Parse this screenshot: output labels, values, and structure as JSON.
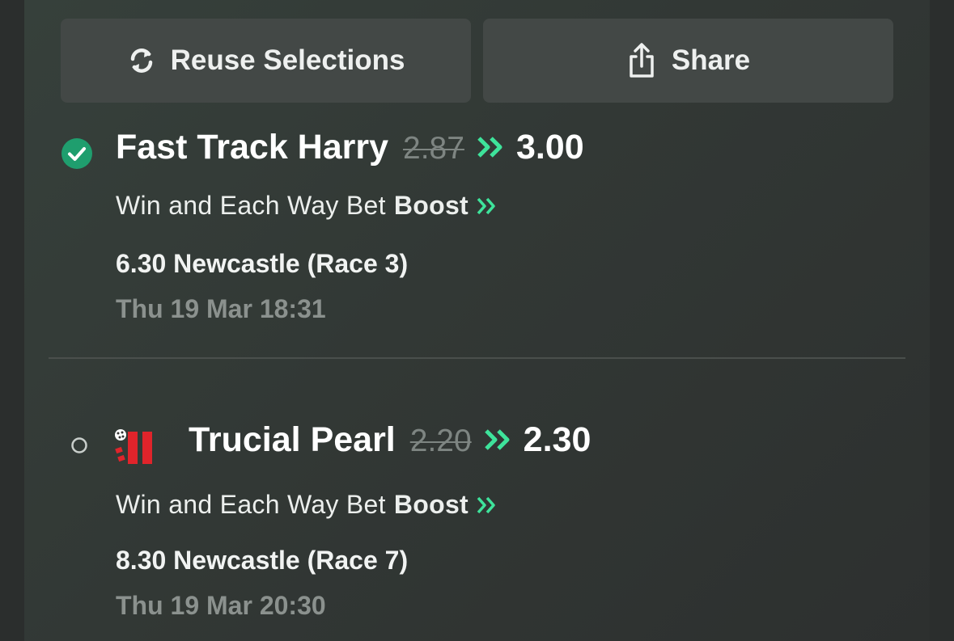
{
  "buttons": {
    "reuse": {
      "label": "Reuse Selections",
      "icon": "refresh-icon"
    },
    "share": {
      "label": "Share",
      "icon": "share-icon"
    }
  },
  "selections": [
    {
      "status": "selected",
      "name": "Fast Track Harry",
      "old_odds": "2.87",
      "new_odds": "3.00",
      "bet_type": "Win and Each Way Bet",
      "boost_label": "Boost",
      "race": "6.30 Newcastle (Race 3)",
      "time": "Thu 19 Mar 18:31"
    },
    {
      "status": "unselected",
      "name": "Trucial Pearl",
      "old_odds": "2.20",
      "new_odds": "2.30",
      "bet_type": "Win and Each Way Bet",
      "boost_label": "Boost",
      "race": "8.30 Newcastle (Race 7)",
      "time": "Thu 19 Mar 20:30"
    }
  ],
  "colors": {
    "accent_green": "#3ee39b",
    "check_green": "#1f9e6e",
    "silk_red": "#e0242b"
  }
}
